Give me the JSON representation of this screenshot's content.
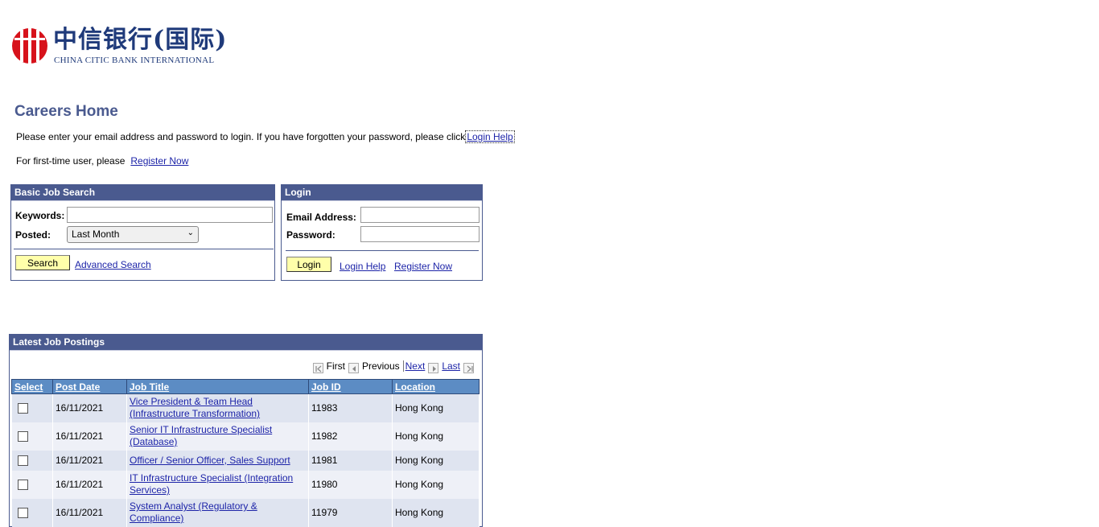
{
  "logo": {
    "chinese": "中信银行(国际)",
    "english": "CHINA CITIC BANK INTERNATIONAL"
  },
  "page": {
    "title": "Careers Home",
    "intro_text": "Please enter your email address and password to login. If you have forgotten your password, please click",
    "intro_link": "Login Help",
    "first_time_text": "For first-time user, please",
    "first_time_link": "Register Now"
  },
  "search": {
    "header": "Basic Job Search",
    "keywords_label": "Keywords:",
    "keywords_value": "",
    "posted_label": "Posted:",
    "posted_value": "Last Month",
    "search_button": "Search",
    "advanced_link": "Advanced Search"
  },
  "login": {
    "header": "Login",
    "email_label": "Email Address:",
    "email_value": "",
    "password_label": "Password:",
    "password_value": "",
    "login_button": "Login",
    "help_link": "Login Help",
    "register_link": "Register Now"
  },
  "jobs": {
    "header": "Latest Job Postings",
    "nav": {
      "first": "First",
      "previous": "Previous",
      "next": "Next",
      "last": "Last"
    },
    "columns": [
      "Select",
      "Post Date",
      "Job Title",
      "Job ID",
      "Location"
    ],
    "rows": [
      {
        "date": "16/11/2021",
        "title": "Vice President & Team Head (Infrastructure Transformation)",
        "id": "11983",
        "location": "Hong Kong"
      },
      {
        "date": "16/11/2021",
        "title": "Senior IT Infrastructure Specialist (Database)",
        "id": "11982",
        "location": "Hong Kong"
      },
      {
        "date": "16/11/2021",
        "title": "Officer / Senior Officer, Sales Support",
        "id": "11981",
        "location": "Hong Kong"
      },
      {
        "date": "16/11/2021",
        "title": "IT Infrastructure Specialist (Integration Services)",
        "id": "11980",
        "location": "Hong Kong"
      },
      {
        "date": "16/11/2021",
        "title": "System Analyst (Regulatory & Compliance)",
        "id": "11979",
        "location": "Hong Kong"
      }
    ]
  }
}
